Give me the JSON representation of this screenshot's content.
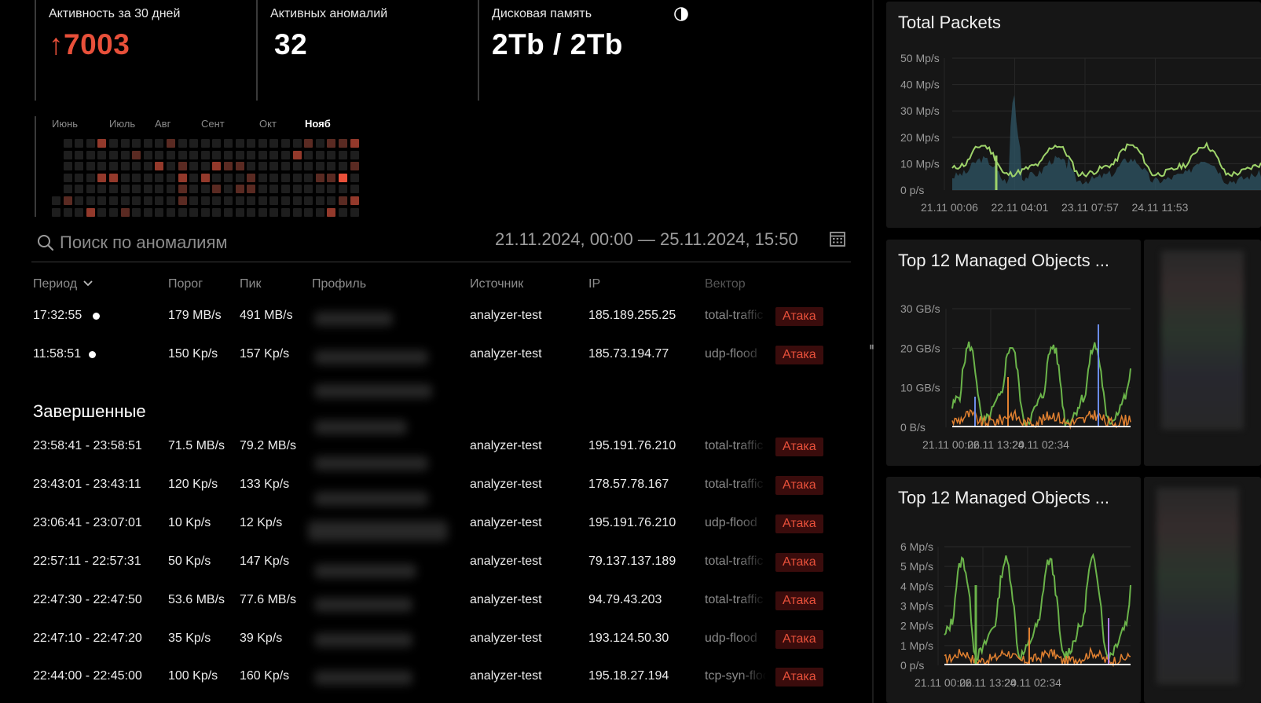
{
  "stats": [
    {
      "label": "Активность за 30 дней",
      "value": "↑7003",
      "color": "#e8503a"
    },
    {
      "label": "Активных аномалий",
      "value": "32"
    },
    {
      "label": "Дисковая память",
      "value": "2Tb / 2Tb",
      "icon": "contrast-half-icon"
    }
  ],
  "heatmap": {
    "months": [
      "Июнь",
      "Июль",
      "Авг",
      "Сент",
      "Окт",
      "Нояб"
    ],
    "active_month": "Нояб",
    "colors": {
      "empty": "#1e1e1e",
      "low": "#5a2a22",
      "mid": "#93392b",
      "high": "#e8503a"
    }
  },
  "search": {
    "placeholder": "Поиск по аномалиям",
    "value": ""
  },
  "daterange": "21.11.2024, 00:00 — 25.11.2024, 15:50",
  "table": {
    "headers": {
      "period": "Период",
      "threshold": "Порог",
      "peak": "Пик",
      "profile": "Профиль",
      "source": "Источник",
      "ip": "IP",
      "vector": "Вектор"
    },
    "active_rows": [
      {
        "period": "17:32:55",
        "threshold": "179 MB/s",
        "peak": "491 MB/s",
        "source": "analyzer-test",
        "ip": "185.189.255.25",
        "vector": "total-traffic",
        "status": "Атака"
      },
      {
        "period": "11:58:51",
        "threshold": "150 Kp/s",
        "peak": "157 Kp/s",
        "source": "analyzer-test",
        "ip": "185.73.194.77",
        "vector": "udp-flood",
        "status": "Атака"
      }
    ],
    "completed_title": "Завершенные",
    "completed_rows": [
      {
        "period": "23:58:41 - 23:58:51",
        "threshold": "71.5 MB/s",
        "peak": "79.2 MB/s",
        "source": "analyzer-test",
        "ip": "195.191.76.210",
        "vector": "total-traffic",
        "status": "Атака"
      },
      {
        "period": "23:43:01 - 23:43:11",
        "threshold": "120 Kp/s",
        "peak": "133 Kp/s",
        "source": "analyzer-test",
        "ip": "178.57.78.167",
        "vector": "total-traffic",
        "status": "Атака"
      },
      {
        "period": "23:06:41 - 23:07:01",
        "threshold": "10 Kp/s",
        "peak": "12 Kp/s",
        "source": "analyzer-test",
        "ip": "195.191.76.210",
        "vector": "udp-flood",
        "status": "Атака"
      },
      {
        "period": "22:57:11 - 22:57:31",
        "threshold": "50 Kp/s",
        "peak": "147 Kp/s",
        "source": "analyzer-test",
        "ip": "79.137.137.189",
        "vector": "total-traffic",
        "status": "Атака"
      },
      {
        "period": "22:47:30 - 22:47:50",
        "threshold": "53.6 MB/s",
        "peak": "77.6 MB/s",
        "source": "analyzer-test",
        "ip": "94.79.43.203",
        "vector": "total-traffic",
        "status": "Атака"
      },
      {
        "period": "22:47:10 - 22:47:20",
        "threshold": "35 Kp/s",
        "peak": "39 Kp/s",
        "source": "analyzer-test",
        "ip": "193.124.50.30",
        "vector": "udp-flood",
        "status": "Атака"
      },
      {
        "period": "22:44:00 - 22:45:00",
        "threshold": "100 Kp/s",
        "peak": "160 Kp/s",
        "source": "analyzer-test",
        "ip": "195.18.27.194",
        "vector": "tcp-syn-flood",
        "status": "Атака"
      }
    ]
  },
  "panels": [
    {
      "title": "Total Packets",
      "yticks": [
        "50 Mp/s",
        "40 Mp/s",
        "30 Mp/s",
        "20 Mp/s",
        "10 Mp/s",
        "0 p/s"
      ],
      "xticks": [
        "21.11 00:06",
        "22.11 04:01",
        "23.11 07:57",
        "24.11 11:53"
      ]
    },
    {
      "title": "Top 12 Managed Objects ...",
      "yticks": [
        "30 GB/s",
        "20 GB/s",
        "10 GB/s",
        "0 B/s"
      ],
      "xticks": [
        "21.11 00:06",
        "22.11 13:20",
        "24.11 02:34"
      ]
    },
    {
      "title": "Top 12 Managed Objects ...",
      "yticks": [
        "6 Mp/s",
        "5 Mp/s",
        "4 Mp/s",
        "3 Mp/s",
        "2 Mp/s",
        "1 Mp/s",
        "0 p/s"
      ],
      "xticks": [
        "21.11 00:06",
        "22.11 13:20",
        "24.11 02:34"
      ]
    }
  ],
  "chart_data": [
    {
      "type": "area",
      "title": "Total Packets",
      "ylim": [
        0,
        50
      ],
      "unit": "Mp/s",
      "xticks": [
        "21.11 00:06",
        "22.11 04:01",
        "23.11 07:57",
        "24.11 11:53"
      ],
      "series": [
        {
          "color": "#9ed36a"
        },
        {
          "color": "#2f5666"
        }
      ]
    },
    {
      "type": "line",
      "title": "Top 12 Managed Objects ...",
      "ylim": [
        0,
        30
      ],
      "unit": "GB/s",
      "xticks": [
        "21.11 00:06",
        "22.11 13:20",
        "24.11 02:34"
      ],
      "series": [
        {
          "color": "#6bb44a"
        },
        {
          "color": "#e08030"
        },
        {
          "color": "#6b8ce8"
        }
      ]
    },
    {
      "type": "line",
      "title": "Top 12 Managed Objects ...",
      "ylim": [
        0,
        6
      ],
      "unit": "Mp/s",
      "xticks": [
        "21.11 00:06",
        "22.11 13:20",
        "24.11 02:34"
      ],
      "series": [
        {
          "color": "#6bb44a"
        },
        {
          "color": "#e08030"
        },
        {
          "color": "#b07be8"
        }
      ]
    }
  ],
  "colors": {
    "accent": "#e8503a",
    "badge_bg": "#3a0c0c",
    "panel_bg": "#161616",
    "muted": "#8c8c8c"
  }
}
